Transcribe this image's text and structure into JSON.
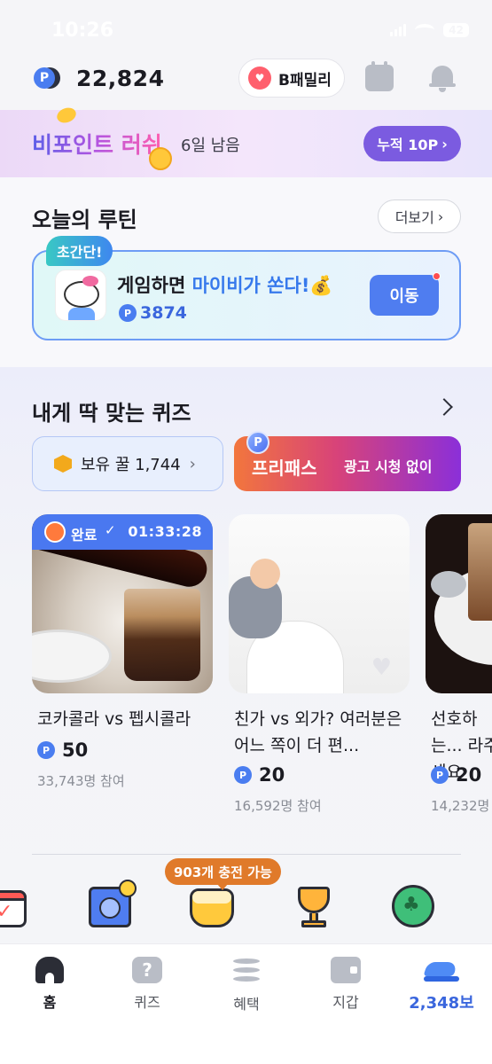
{
  "status_bar": {
    "time": "10:26",
    "battery": "42"
  },
  "header": {
    "coin_symbol": "P",
    "points": "22,824",
    "family_label": "B패밀리"
  },
  "banner": {
    "title": "비포인트 러쉬",
    "days_left": "6일 남음",
    "cumulative_label": "누적 10P",
    "cumulative_chevron": "›"
  },
  "routine": {
    "title": "오늘의 루틴",
    "more_label": "더보기",
    "more_chevron": "›",
    "badge": "초간단!",
    "message_prefix": "게임하면 ",
    "message_highlight": "마이비가 쏜다!",
    "message_emoji": "💰",
    "points": "3874",
    "move_label": "이동"
  },
  "quiz": {
    "title": "내게 딱 맞는 퀴즈",
    "honey_label": "보유 꿀 1,744",
    "honey_chevron": "›",
    "freepass_title": "프리패스",
    "freepass_sub": "광고 시청 없이",
    "cards": [
      {
        "status": "완료",
        "check": "✓",
        "timer": "01:33:28",
        "title": "코카콜라 vs 펩시콜라",
        "points": "50",
        "participants": "33,743명 참여"
      },
      {
        "title": "친가 vs 외가? 여러분은 어느 쪽이 더 편...",
        "points": "20",
        "participants": "16,592명 참여"
      },
      {
        "title": "선호하는... 라주세요",
        "points": "20",
        "participants": "14,232명"
      }
    ]
  },
  "icon_row": {
    "charge_tip": "903개 충전 가능",
    "items": [
      "calendar-check-icon",
      "safe-icon",
      "honey-jar-icon",
      "trophy-icon",
      "clover-icon"
    ]
  },
  "tabbar": {
    "tabs": [
      {
        "label": "홈",
        "icon": "home-icon"
      },
      {
        "label": "퀴즈",
        "icon": "quiz-icon"
      },
      {
        "label": "혜택",
        "icon": "coins-icon"
      },
      {
        "label": "지갑",
        "icon": "wallet-icon"
      },
      {
        "label": "2,348보",
        "icon": "sneaker-icon"
      }
    ]
  }
}
